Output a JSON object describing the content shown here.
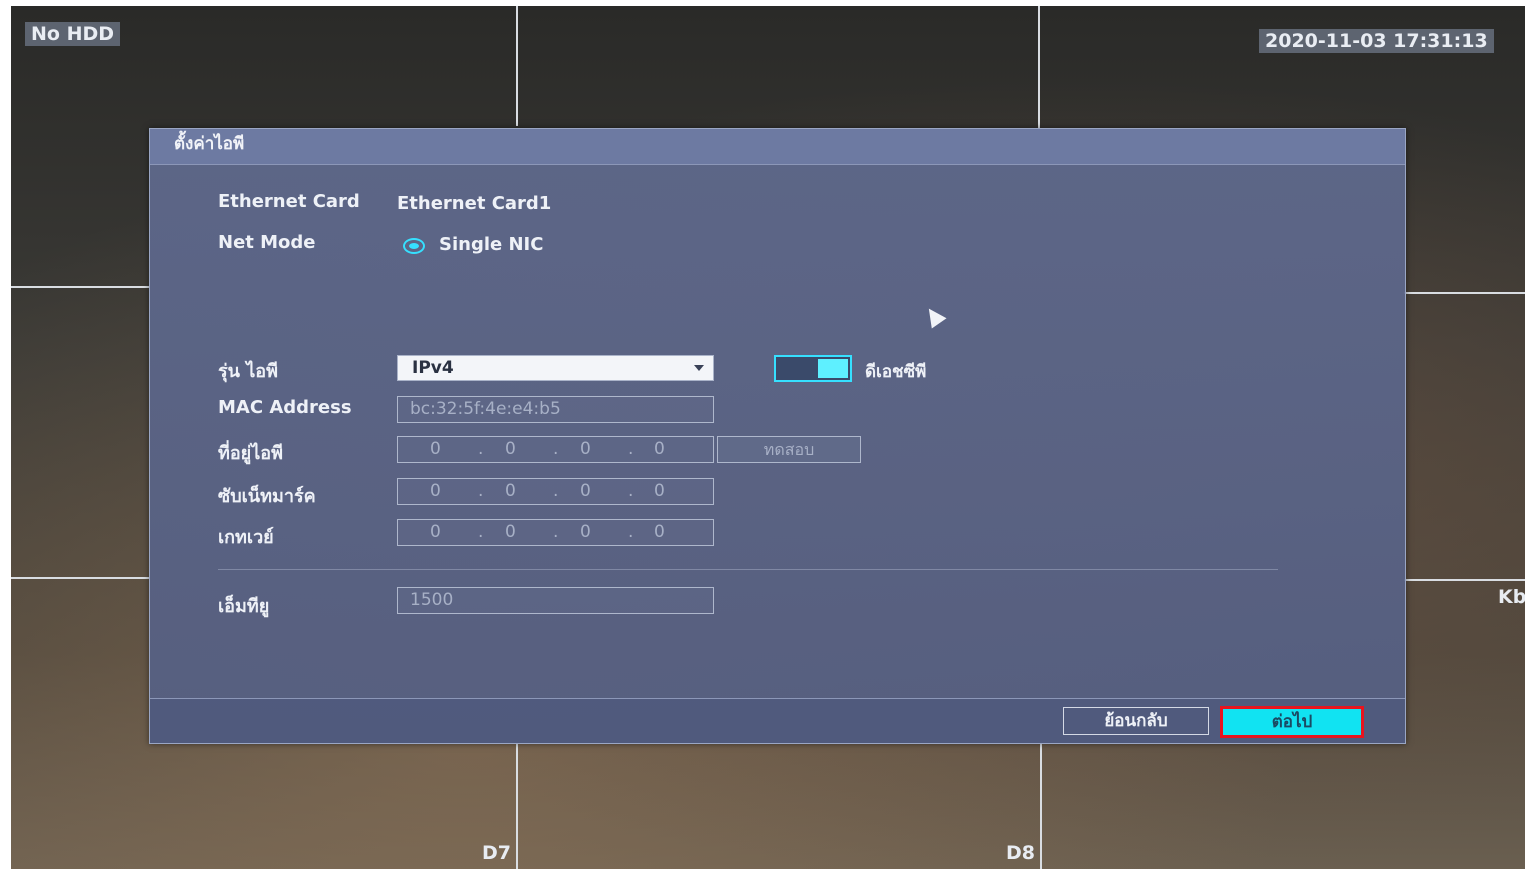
{
  "osd": {
    "hdd_status": "No HDD",
    "datetime": "2020-11-03 17:31:13",
    "channel_labels": [
      "D7",
      "D8"
    ],
    "right_edge_label": "Kb"
  },
  "dialog": {
    "title": "ตั้งค่าไอพี",
    "ethernet_card": {
      "label": "Ethernet Card",
      "value": "Ethernet Card1"
    },
    "net_mode": {
      "label": "Net Mode",
      "value": "Single NIC",
      "selected": true
    },
    "ip_version": {
      "label": "รุ่น ไอพี",
      "value": "IPv4"
    },
    "dhcp": {
      "label": "ดีเอชซีพี",
      "enabled": true
    },
    "mac_address": {
      "label": "MAC Address",
      "value": "bc:32:5f:4e:e4:b5"
    },
    "ip_address": {
      "label": "ที่อยู่ไอพี",
      "octets": [
        "0",
        "0",
        "0",
        "0"
      ]
    },
    "test_button": "ทดสอบ",
    "subnet_mask": {
      "label": "ซับเน็ทมาร์ค",
      "octets": [
        "0",
        "0",
        "0",
        "0"
      ]
    },
    "gateway": {
      "label": "เกทเวย์",
      "octets": [
        "0",
        "0",
        "0",
        "0"
      ]
    },
    "mtu": {
      "label": "เอ็มทียู",
      "value": "1500"
    },
    "back_button": "ย้อนกลับ",
    "next_button": "ต่อไป"
  },
  "colors": {
    "accent": "#11e3f2",
    "highlight_border": "#e8141e",
    "dialog_bg": "#5f6a8c"
  },
  "icons": [
    "radio-selected-icon",
    "dropdown-caret-icon",
    "mouse-cursor-icon"
  ]
}
